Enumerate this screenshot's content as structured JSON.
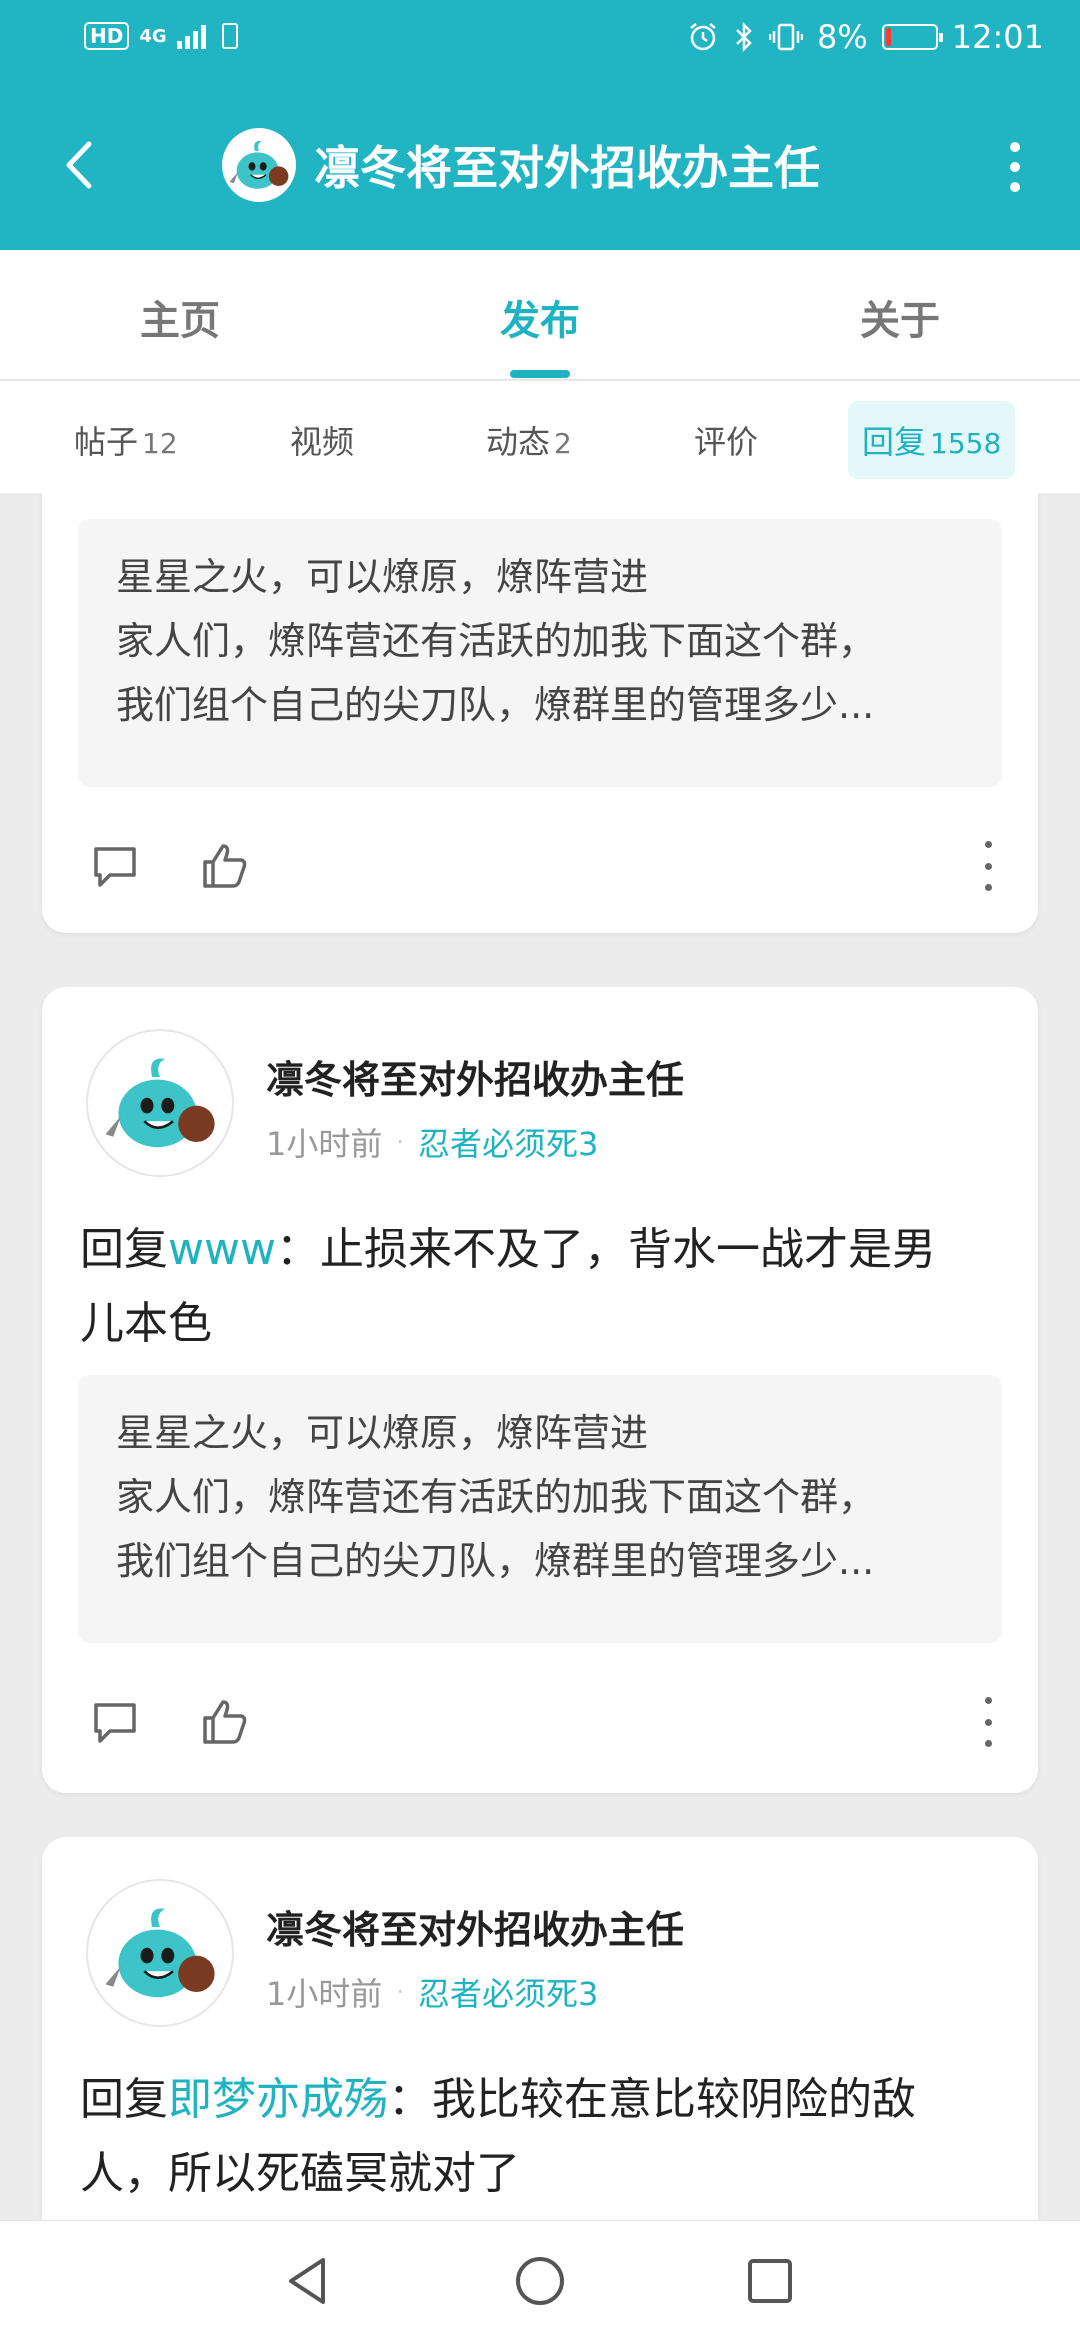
{
  "status_bar": {
    "hd": "HD",
    "network": "4G",
    "battery_percent": "8%",
    "time": "12:01"
  },
  "header": {
    "title": "凛冬将至对外招收办主任"
  },
  "main_tabs": [
    {
      "label": "主页"
    },
    {
      "label": "发布"
    },
    {
      "label": "关于"
    }
  ],
  "sub_tabs": [
    {
      "label": "帖子",
      "count": "12"
    },
    {
      "label": "视频",
      "count": ""
    },
    {
      "label": "动态",
      "count": "2"
    },
    {
      "label": "评价",
      "count": ""
    },
    {
      "label": "回复",
      "count": "1558"
    }
  ],
  "posts": [
    {
      "quote_title": "星星之火，可以燎原，燎阵营进",
      "quote_body_1": "家人们，燎阵营还有活跃的加我下面这个群，",
      "quote_body_2": "我们组个自己的尖刀队，燎群里的管理多少..."
    },
    {
      "author": "凛冬将至对外招收办主任",
      "time": "1小时前",
      "tag": "忍者必须死3",
      "reply_prefix": "回复",
      "reply_to": "www",
      "reply_text_1": "：止损来不及了，背水一战才是男",
      "reply_text_2": "儿本色",
      "quote_title": "星星之火，可以燎原，燎阵营进",
      "quote_body_1": "家人们，燎阵营还有活跃的加我下面这个群，",
      "quote_body_2": "我们组个自己的尖刀队，燎群里的管理多少..."
    },
    {
      "author": "凛冬将至对外招收办主任",
      "time": "1小时前",
      "tag": "忍者必须死3",
      "reply_prefix": "回复",
      "reply_to": "即梦亦成殇",
      "reply_text_1": "：我比较在意比较阴险的敌",
      "reply_text_2": "人，所以死磕冥就对了"
    }
  ],
  "colors": {
    "accent": "#1fb3c2",
    "header_bg": "#21b5c4"
  }
}
